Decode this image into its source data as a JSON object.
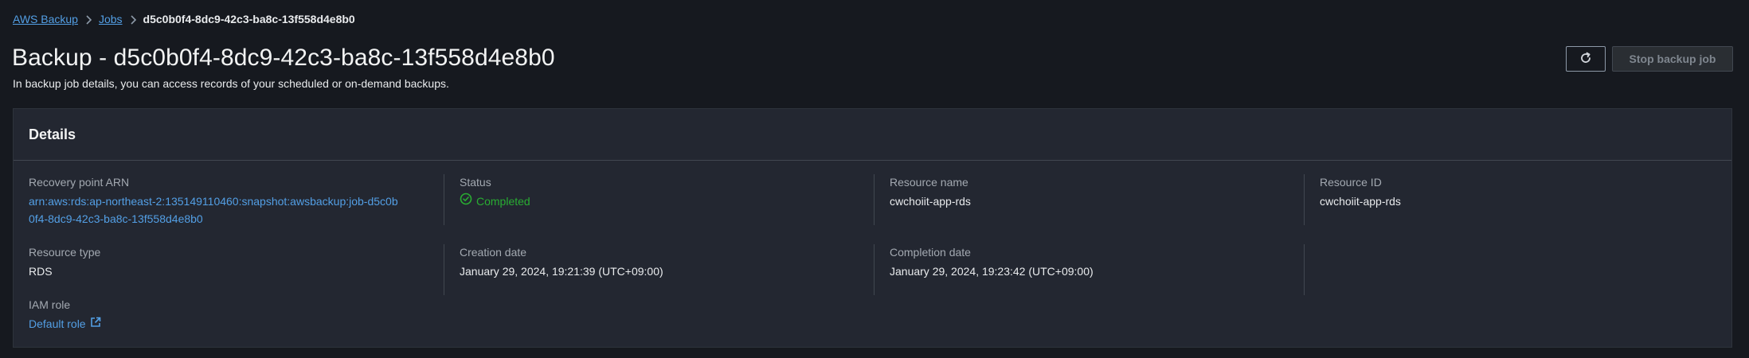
{
  "breadcrumb": {
    "items": [
      "AWS Backup",
      "Jobs"
    ],
    "current": "d5c0b0f4-8dc9-42c3-ba8c-13f558d4e8b0"
  },
  "header": {
    "title": "Backup - d5c0b0f4-8dc9-42c3-ba8c-13f558d4e8b0",
    "description": "In backup job details, you can access records of your scheduled or on-demand backups.",
    "stop_label": "Stop backup job",
    "refresh_icon": "refresh-icon"
  },
  "details": {
    "title": "Details",
    "recovery_point_arn_label": "Recovery point ARN",
    "recovery_point_arn": "arn:aws:rds:ap-northeast-2:135149110460:snapshot:awsbackup:job-d5c0b0f4-8dc9-42c3-ba8c-13f558d4e8b0",
    "status_label": "Status",
    "status": "Completed",
    "resource_name_label": "Resource name",
    "resource_name": "cwchoiit-app-rds",
    "resource_id_label": "Resource ID",
    "resource_id": "cwchoiit-app-rds",
    "resource_type_label": "Resource type",
    "resource_type": "RDS",
    "creation_date_label": "Creation date",
    "creation_date": "January 29, 2024, 19:21:39 (UTC+09:00)",
    "completion_date_label": "Completion date",
    "completion_date": "January 29, 2024, 19:23:42 (UTC+09:00)",
    "iam_role_label": "IAM role",
    "iam_role": "Default role"
  },
  "colors": {
    "background": "#16191f",
    "panel": "#232731",
    "link": "#539fe5",
    "success": "#29ad32"
  }
}
